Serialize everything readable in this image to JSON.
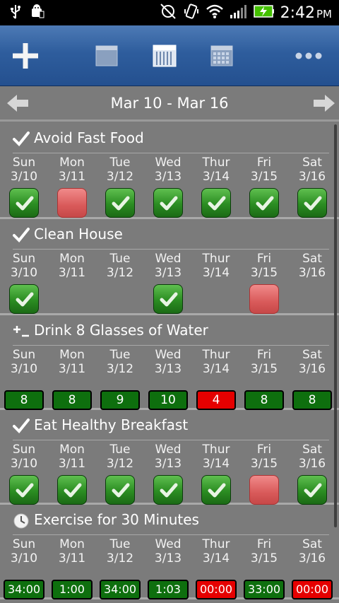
{
  "status_bar": {
    "time": "2:42",
    "ampm": "PM"
  },
  "week_range": "Mar 10 - Mar 16",
  "days": [
    {
      "name": "Sun",
      "date": "3/10"
    },
    {
      "name": "Mon",
      "date": "3/11"
    },
    {
      "name": "Tue",
      "date": "3/12"
    },
    {
      "name": "Wed",
      "date": "3/13"
    },
    {
      "name": "Thur",
      "date": "3/14"
    },
    {
      "name": "Fri",
      "date": "3/15"
    },
    {
      "name": "Sat",
      "date": "3/16"
    }
  ],
  "habits": [
    {
      "title": "Avoid Fast Food",
      "icon": "check-icon",
      "type": "check",
      "cells": [
        "done",
        "missed",
        "done",
        "done",
        "done",
        "done",
        "done"
      ]
    },
    {
      "title": "Clean House",
      "icon": "check-icon",
      "type": "check",
      "cells": [
        "done",
        "none",
        "none",
        "done",
        "none",
        "missed",
        "none"
      ]
    },
    {
      "title": "Drink 8 Glasses of Water",
      "icon": "plus-minus-icon",
      "type": "count",
      "cells": [
        {
          "v": "8",
          "s": "good"
        },
        {
          "v": "8",
          "s": "good"
        },
        {
          "v": "9",
          "s": "good"
        },
        {
          "v": "10",
          "s": "good"
        },
        {
          "v": "4",
          "s": "bad"
        },
        {
          "v": "8",
          "s": "good"
        },
        {
          "v": "8",
          "s": "good"
        }
      ]
    },
    {
      "title": "Eat Healthy Breakfast",
      "icon": "check-icon",
      "type": "check",
      "cells": [
        "done",
        "done",
        "done",
        "done",
        "done",
        "missed",
        "done"
      ]
    },
    {
      "title": "Exercise for 30 Minutes",
      "icon": "clock-icon",
      "type": "count",
      "cells": [
        {
          "v": "34:00",
          "s": "good"
        },
        {
          "v": "1:00",
          "s": "good"
        },
        {
          "v": "34:00",
          "s": "good"
        },
        {
          "v": "1:03",
          "s": "good"
        },
        {
          "v": "00:00",
          "s": "bad"
        },
        {
          "v": "33:00",
          "s": "good"
        },
        {
          "v": "00:00",
          "s": "bad"
        }
      ]
    }
  ],
  "colors": {
    "toolbar": "#2e5d9d",
    "done": "#2b8d22",
    "missed": "#d95a5a",
    "count_good": "#0e6f0e",
    "count_bad": "#e50000"
  }
}
